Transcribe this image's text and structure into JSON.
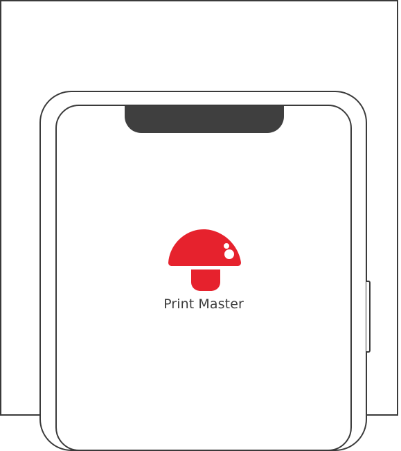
{
  "app": {
    "name": "Print Master",
    "logo_icon": "mushroom-icon",
    "brand_color": "#e6222d",
    "highlight_color": "#ffffff"
  },
  "device": {
    "frame_color": "#3a3a3a",
    "notch_color": "#3f3f3f"
  }
}
